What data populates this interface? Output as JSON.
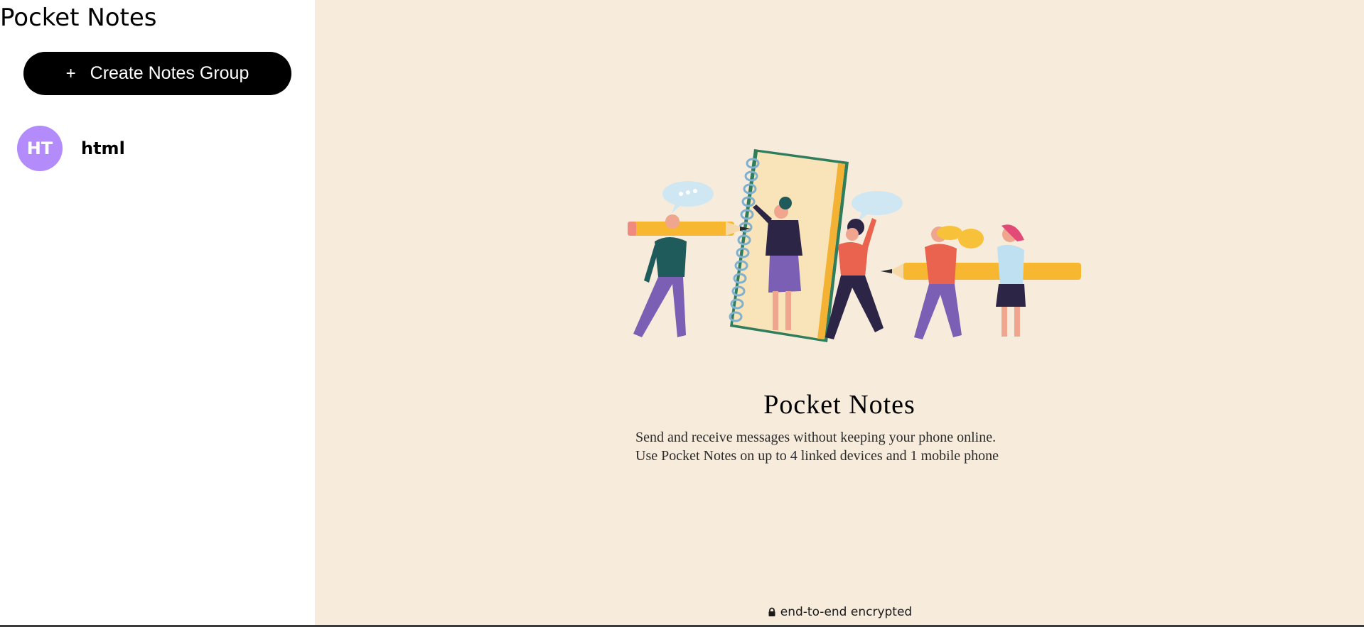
{
  "app": {
    "title": "Pocket Notes"
  },
  "sidebar": {
    "create_button": {
      "icon_glyph": "+",
      "label": "Create Notes Group"
    },
    "groups": [
      {
        "initials": "HT",
        "name": "html",
        "avatar_color": "#b38bfa"
      }
    ]
  },
  "main": {
    "background_color": "#f7ebdb",
    "illustration_icon": "people-with-notebook-illustration",
    "welcome_title": "Pocket Notes",
    "description_lines": [
      "Send and receive messages without keeping your phone online.",
      "Use Pocket Notes on up to 4 linked devices and 1 mobile phone"
    ],
    "footer": {
      "icon": "lock-icon",
      "text": "end-to-end encrypted"
    }
  }
}
